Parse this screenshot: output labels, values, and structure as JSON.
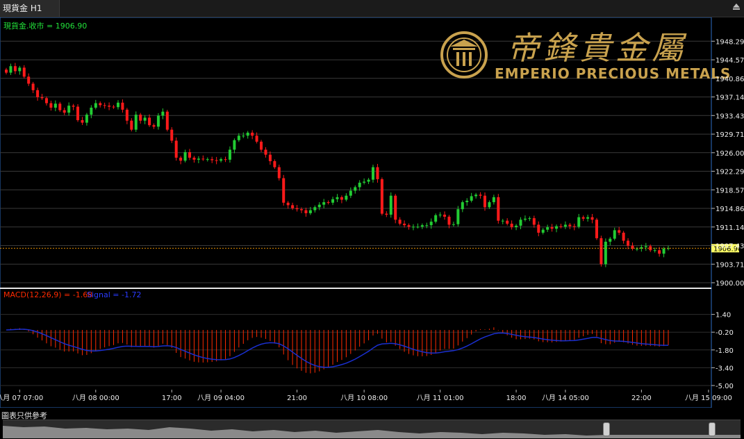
{
  "window": {
    "tab_label": "現貨金 H1"
  },
  "chart_header": {
    "label": "現貨金.收市 = 1906.90"
  },
  "logo": {
    "chinese": "帝鋒貴金屬",
    "english": "EMPERIO PRECIOUS METALS"
  },
  "footer_note": "圖表只供參考",
  "colors": {
    "up": "#22cc33",
    "down": "#ff1a1a",
    "last_price_line": "#e08a00",
    "macd_hist": "#ff2a00",
    "signal": "#1a2fd0",
    "price_tag_bg": "#ffff66",
    "logo_gold": "#c9a24e"
  },
  "chart_data": [
    {
      "type": "candlestick",
      "ylim": [
        1900.0,
        1950.0
      ],
      "y_ticks": [
        "1948.29",
        "1944.57",
        "1940.86",
        "1937.14",
        "1933.43",
        "1929.71",
        "1926.00",
        "1922.29",
        "1918.57",
        "1914.86",
        "1911.14",
        "1907.43",
        "1903.71",
        "1900.00"
      ],
      "last_price": 1906.9,
      "last_price_label": "1906.90",
      "x_ticks": [
        {
          "label": "八月 07 07:00",
          "index": 3
        },
        {
          "label": "八月 08 00:00",
          "index": 20
        },
        {
          "label": "17:00",
          "index": 37
        },
        {
          "label": "八月 09 04:00",
          "index": 48
        },
        {
          "label": "21:00",
          "index": 65
        },
        {
          "label": "八月 10 08:00",
          "index": 80
        },
        {
          "label": "八月 11 01:00",
          "index": 97
        },
        {
          "label": "18:00",
          "index": 114
        },
        {
          "label": "八月 14 05:00",
          "index": 125
        },
        {
          "label": "22:00",
          "index": 142
        },
        {
          "label": "八月 15 09:00",
          "index": 157
        }
      ],
      "closes": [
        1942.0,
        1943.3,
        1942.3,
        1943.0,
        1941.2,
        1939.8,
        1938.5,
        1937.1,
        1936.9,
        1935.9,
        1935.0,
        1935.8,
        1934.5,
        1934.0,
        1935.4,
        1935.2,
        1932.5,
        1932.0,
        1933.6,
        1935.0,
        1935.9,
        1935.5,
        1935.4,
        1935.2,
        1935.1,
        1936.0,
        1934.6,
        1932.4,
        1930.6,
        1933.6,
        1932.4,
        1933.0,
        1931.5,
        1931.2,
        1933.4,
        1934.2,
        1930.6,
        1928.4,
        1925.0,
        1924.4,
        1926.1,
        1925.0,
        1924.6,
        1924.8,
        1924.7,
        1924.7,
        1924.5,
        1924.4,
        1924.7,
        1924.6,
        1926.6,
        1928.5,
        1929.4,
        1929.4,
        1930.0,
        1929.4,
        1928.2,
        1926.6,
        1925.6,
        1924.3,
        1923.1,
        1920.9,
        1916.0,
        1915.5,
        1914.9,
        1914.7,
        1914.5,
        1913.9,
        1914.5,
        1915.1,
        1915.6,
        1916.1,
        1916.0,
        1916.7,
        1917.1,
        1916.6,
        1917.4,
        1918.4,
        1919.1,
        1920.0,
        1920.2,
        1920.6,
        1923.1,
        1920.7,
        1913.8,
        1913.6,
        1917.4,
        1912.6,
        1911.8,
        1911.5,
        1911.2,
        1911.2,
        1911.2,
        1911.5,
        1911.5,
        1912.2,
        1913.5,
        1913.6,
        1913.2,
        1911.6,
        1911.7,
        1914.7,
        1916.1,
        1916.4,
        1917.3,
        1917.6,
        1917.4,
        1915.1,
        1916.1,
        1917.1,
        1912.4,
        1912.4,
        1911.8,
        1911.1,
        1911.4,
        1912.6,
        1912.8,
        1912.9,
        1911.6,
        1910.0,
        1910.6,
        1911.1,
        1910.8,
        1911.3,
        1911.2,
        1911.6,
        1911.3,
        1911.2,
        1913.1,
        1912.8,
        1913.1,
        1912.6,
        1908.9,
        1903.7,
        1908.2,
        1908.8,
        1910.5,
        1910.0,
        1908.4,
        1907.4,
        1906.8,
        1906.8,
        1907.1,
        1907.3,
        1906.5,
        1906.5,
        1905.8,
        1906.8,
        1906.9
      ],
      "macd": {
        "label": "MACD(12,26,9) = -1.68",
        "value": -1.68,
        "ylim": [
          -5.0,
          2.5
        ],
        "y_ticks": [
          "1.40",
          "-0.20",
          "-1.80",
          "-3.40",
          "-5.00"
        ]
      },
      "signal": {
        "label": "Signal = -1.72",
        "value": -1.72
      }
    }
  ]
}
